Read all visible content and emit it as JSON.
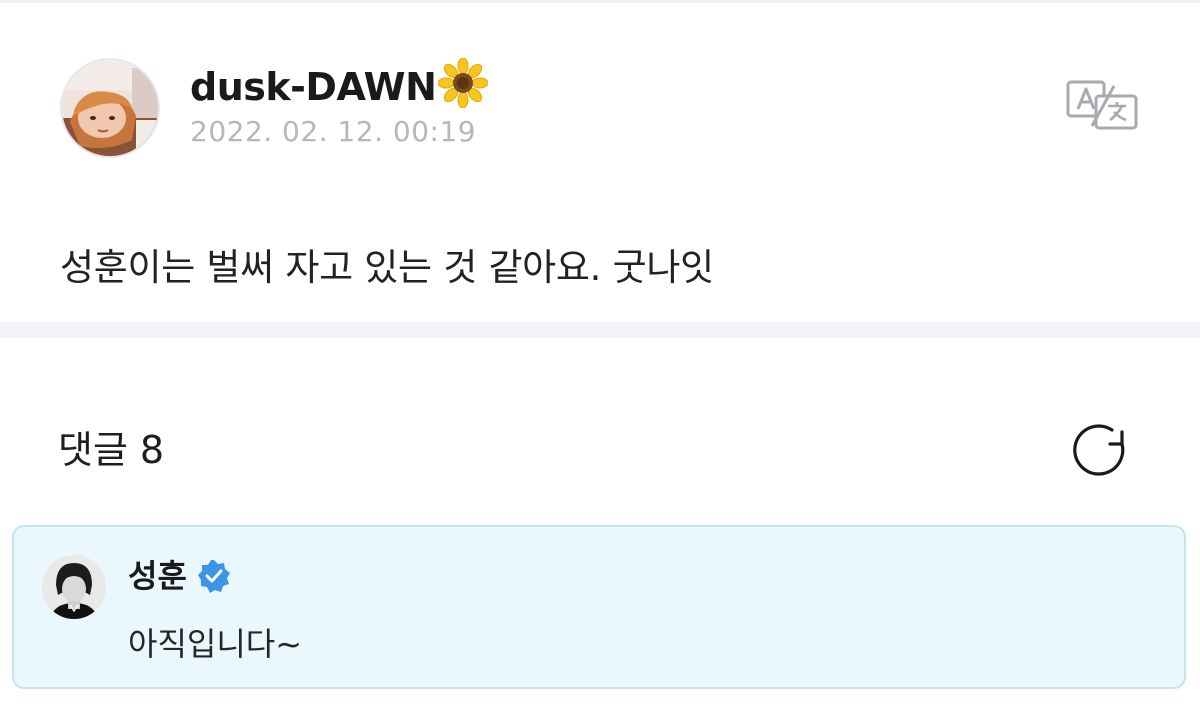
{
  "post": {
    "author_name": "dusk-DAWN",
    "author_emoji": "sunflower",
    "date": "2022. 02. 12. 00:19",
    "body": "성훈이는 벌써 자고 있는 것 같아요. 굿나잇"
  },
  "comments": {
    "label": "댓글",
    "count": "8",
    "items": [
      {
        "name": "성훈",
        "verified": true,
        "text": "아직입니다~"
      }
    ]
  },
  "colors": {
    "highlight_bg": "#eaf7fd",
    "highlight_border": "#c7e3ef",
    "verified_blue": "#3d95e6",
    "date_gray": "#b6b6bd",
    "divider": "#f3f4f8"
  },
  "icons": {
    "translate": "translate-icon",
    "refresh": "refresh-icon",
    "verified": "verified-badge-icon"
  }
}
